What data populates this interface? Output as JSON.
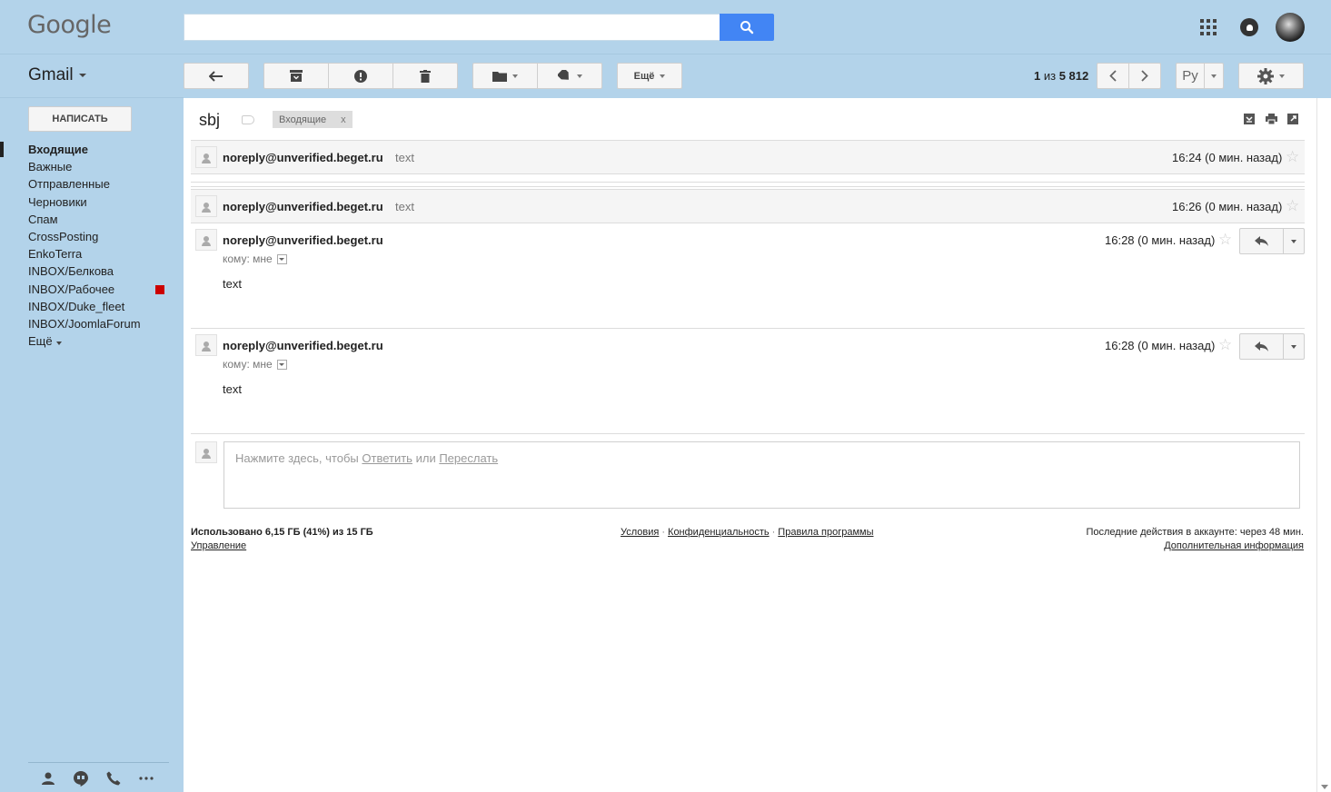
{
  "header": {
    "logo": "Google",
    "search": {
      "value": "",
      "placeholder": ""
    }
  },
  "toolbar": {
    "app_label": "Gmail",
    "more_label": "Ещё",
    "pager": {
      "current": "1",
      "separator": "из",
      "total": "5 812"
    },
    "lang_label": "Ру"
  },
  "sidebar": {
    "compose_label": "НАПИСАТЬ",
    "items": [
      {
        "label": "Входящие",
        "active": true
      },
      {
        "label": "Важные"
      },
      {
        "label": "Отправленные"
      },
      {
        "label": "Черновики"
      },
      {
        "label": "Спам"
      },
      {
        "label": "CrossPosting"
      },
      {
        "label": "EnkoTerra"
      },
      {
        "label": "INBOX/Белкова"
      },
      {
        "label": "INBOX/Рабочее",
        "label_color": "#cc0000"
      },
      {
        "label": "INBOX/Duke_fleet"
      },
      {
        "label": "INBOX/JoomlaForum"
      },
      {
        "label": "Ещё"
      }
    ]
  },
  "thread": {
    "subject": "sbj",
    "label_chip": {
      "name": "Входящие",
      "remove": "x"
    },
    "messages": [
      {
        "sender": "noreply@unverified.beget.ru",
        "snippet": "text",
        "time": "16:24 (0 мин. назад)",
        "expanded": false
      },
      {
        "sender": "noreply@unverified.beget.ru",
        "snippet": "text",
        "time": "16:26 (0 мин. назад)",
        "expanded": false
      },
      {
        "sender": "noreply@unverified.beget.ru",
        "to": "кому: мне",
        "body": "text",
        "time": "16:28 (0 мин. назад)",
        "expanded": true
      },
      {
        "sender": "noreply@unverified.beget.ru",
        "to": "кому: мне",
        "body": "text",
        "time": "16:28 (0 мин. назад)",
        "expanded": true
      }
    ],
    "reply_box": {
      "prefix": "Нажмите здесь, чтобы",
      "reply_link": "Ответить",
      "or": "или",
      "forward_link": "Переслать"
    }
  },
  "footer": {
    "storage": "Использовано 6,15 ГБ (41%) из 15 ГБ",
    "manage": "Управление",
    "links": [
      "Условия",
      "Конфиденциальность",
      "Правила программы"
    ],
    "last_activity": "Последние действия в аккаунте: через 48 мин.",
    "more_info": "Дополнительная информация"
  },
  "colors": {
    "background": "#b3d3ea",
    "search_button": "#4285f4",
    "label_rabochee": "#cc0000"
  }
}
